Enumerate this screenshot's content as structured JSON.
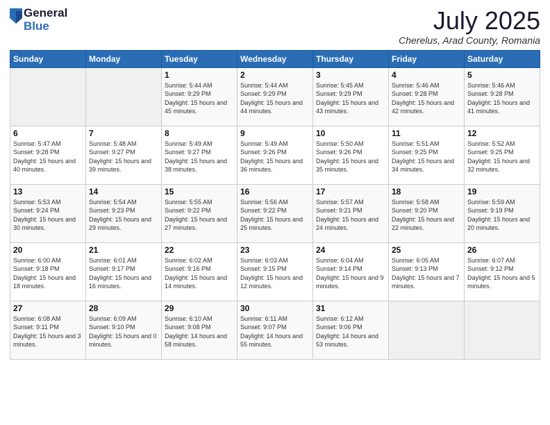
{
  "logo": {
    "general": "General",
    "blue": "Blue"
  },
  "header": {
    "title": "July 2025",
    "subtitle": "Cherelus, Arad County, Romania"
  },
  "days_of_week": [
    "Sunday",
    "Monday",
    "Tuesday",
    "Wednesday",
    "Thursday",
    "Friday",
    "Saturday"
  ],
  "weeks": [
    [
      {
        "day": "",
        "sunrise": "",
        "sunset": "",
        "daylight": ""
      },
      {
        "day": "",
        "sunrise": "",
        "sunset": "",
        "daylight": ""
      },
      {
        "day": "1",
        "sunrise": "Sunrise: 5:44 AM",
        "sunset": "Sunset: 9:29 PM",
        "daylight": "Daylight: 15 hours and 45 minutes."
      },
      {
        "day": "2",
        "sunrise": "Sunrise: 5:44 AM",
        "sunset": "Sunset: 9:29 PM",
        "daylight": "Daylight: 15 hours and 44 minutes."
      },
      {
        "day": "3",
        "sunrise": "Sunrise: 5:45 AM",
        "sunset": "Sunset: 9:29 PM",
        "daylight": "Daylight: 15 hours and 43 minutes."
      },
      {
        "day": "4",
        "sunrise": "Sunrise: 5:46 AM",
        "sunset": "Sunset: 9:28 PM",
        "daylight": "Daylight: 15 hours and 42 minutes."
      },
      {
        "day": "5",
        "sunrise": "Sunrise: 5:46 AM",
        "sunset": "Sunset: 9:28 PM",
        "daylight": "Daylight: 15 hours and 41 minutes."
      }
    ],
    [
      {
        "day": "6",
        "sunrise": "Sunrise: 5:47 AM",
        "sunset": "Sunset: 9:28 PM",
        "daylight": "Daylight: 15 hours and 40 minutes."
      },
      {
        "day": "7",
        "sunrise": "Sunrise: 5:48 AM",
        "sunset": "Sunset: 9:27 PM",
        "daylight": "Daylight: 15 hours and 39 minutes."
      },
      {
        "day": "8",
        "sunrise": "Sunrise: 5:49 AM",
        "sunset": "Sunset: 9:27 PM",
        "daylight": "Daylight: 15 hours and 38 minutes."
      },
      {
        "day": "9",
        "sunrise": "Sunrise: 5:49 AM",
        "sunset": "Sunset: 9:26 PM",
        "daylight": "Daylight: 15 hours and 36 minutes."
      },
      {
        "day": "10",
        "sunrise": "Sunrise: 5:50 AM",
        "sunset": "Sunset: 9:26 PM",
        "daylight": "Daylight: 15 hours and 35 minutes."
      },
      {
        "day": "11",
        "sunrise": "Sunrise: 5:51 AM",
        "sunset": "Sunset: 9:25 PM",
        "daylight": "Daylight: 15 hours and 34 minutes."
      },
      {
        "day": "12",
        "sunrise": "Sunrise: 5:52 AM",
        "sunset": "Sunset: 9:25 PM",
        "daylight": "Daylight: 15 hours and 32 minutes."
      }
    ],
    [
      {
        "day": "13",
        "sunrise": "Sunrise: 5:53 AM",
        "sunset": "Sunset: 9:24 PM",
        "daylight": "Daylight: 15 hours and 30 minutes."
      },
      {
        "day": "14",
        "sunrise": "Sunrise: 5:54 AM",
        "sunset": "Sunset: 9:23 PM",
        "daylight": "Daylight: 15 hours and 29 minutes."
      },
      {
        "day": "15",
        "sunrise": "Sunrise: 5:55 AM",
        "sunset": "Sunset: 9:22 PM",
        "daylight": "Daylight: 15 hours and 27 minutes."
      },
      {
        "day": "16",
        "sunrise": "Sunrise: 5:56 AM",
        "sunset": "Sunset: 9:22 PM",
        "daylight": "Daylight: 15 hours and 25 minutes."
      },
      {
        "day": "17",
        "sunrise": "Sunrise: 5:57 AM",
        "sunset": "Sunset: 9:21 PM",
        "daylight": "Daylight: 15 hours and 24 minutes."
      },
      {
        "day": "18",
        "sunrise": "Sunrise: 5:58 AM",
        "sunset": "Sunset: 9:20 PM",
        "daylight": "Daylight: 15 hours and 22 minutes."
      },
      {
        "day": "19",
        "sunrise": "Sunrise: 5:59 AM",
        "sunset": "Sunset: 9:19 PM",
        "daylight": "Daylight: 15 hours and 20 minutes."
      }
    ],
    [
      {
        "day": "20",
        "sunrise": "Sunrise: 6:00 AM",
        "sunset": "Sunset: 9:18 PM",
        "daylight": "Daylight: 15 hours and 18 minutes."
      },
      {
        "day": "21",
        "sunrise": "Sunrise: 6:01 AM",
        "sunset": "Sunset: 9:17 PM",
        "daylight": "Daylight: 15 hours and 16 minutes."
      },
      {
        "day": "22",
        "sunrise": "Sunrise: 6:02 AM",
        "sunset": "Sunset: 9:16 PM",
        "daylight": "Daylight: 15 hours and 14 minutes."
      },
      {
        "day": "23",
        "sunrise": "Sunrise: 6:03 AM",
        "sunset": "Sunset: 9:15 PM",
        "daylight": "Daylight: 15 hours and 12 minutes."
      },
      {
        "day": "24",
        "sunrise": "Sunrise: 6:04 AM",
        "sunset": "Sunset: 9:14 PM",
        "daylight": "Daylight: 15 hours and 9 minutes."
      },
      {
        "day": "25",
        "sunrise": "Sunrise: 6:05 AM",
        "sunset": "Sunset: 9:13 PM",
        "daylight": "Daylight: 15 hours and 7 minutes."
      },
      {
        "day": "26",
        "sunrise": "Sunrise: 6:07 AM",
        "sunset": "Sunset: 9:12 PM",
        "daylight": "Daylight: 15 hours and 5 minutes."
      }
    ],
    [
      {
        "day": "27",
        "sunrise": "Sunrise: 6:08 AM",
        "sunset": "Sunset: 9:11 PM",
        "daylight": "Daylight: 15 hours and 3 minutes."
      },
      {
        "day": "28",
        "sunrise": "Sunrise: 6:09 AM",
        "sunset": "Sunset: 9:10 PM",
        "daylight": "Daylight: 15 hours and 0 minutes."
      },
      {
        "day": "29",
        "sunrise": "Sunrise: 6:10 AM",
        "sunset": "Sunset: 9:08 PM",
        "daylight": "Daylight: 14 hours and 58 minutes."
      },
      {
        "day": "30",
        "sunrise": "Sunrise: 6:11 AM",
        "sunset": "Sunset: 9:07 PM",
        "daylight": "Daylight: 14 hours and 55 minutes."
      },
      {
        "day": "31",
        "sunrise": "Sunrise: 6:12 AM",
        "sunset": "Sunset: 9:06 PM",
        "daylight": "Daylight: 14 hours and 53 minutes."
      },
      {
        "day": "",
        "sunrise": "",
        "sunset": "",
        "daylight": ""
      },
      {
        "day": "",
        "sunrise": "",
        "sunset": "",
        "daylight": ""
      }
    ]
  ]
}
